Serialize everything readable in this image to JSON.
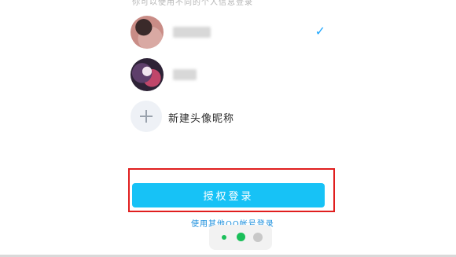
{
  "hint_text": "你可以使用不同的个人信息登录",
  "accounts": [
    {
      "name": "",
      "selected": true
    },
    {
      "name": "",
      "selected": false
    }
  ],
  "new_account_label": "新建头像昵称",
  "check_mark": "✓",
  "authorize_button_label": "授权登录",
  "other_account_link": "使用其他QQ帐号登录",
  "pager": {
    "total": 3,
    "active": 2
  },
  "colors": {
    "accent": "#17c2f6",
    "link": "#1b8fdd",
    "highlight_frame": "#e01e1e",
    "check": "#1ea7ff",
    "pager_active": "#1bbf5a"
  }
}
